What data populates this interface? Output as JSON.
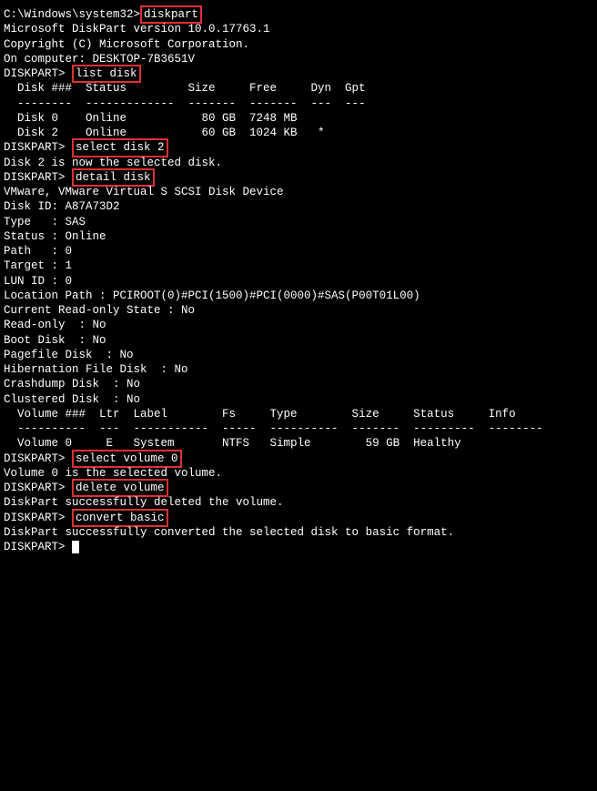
{
  "line1_prefix": "C:\\Windows\\system32>",
  "cmd_diskpart": "diskpart",
  "blank": "",
  "version_line": "Microsoft DiskPart version 10.0.17763.1",
  "copyright_line": "Copyright (C) Microsoft Corporation.",
  "computer_line": "On computer: DESKTOP-7B3651V",
  "prompt": "DISKPART> ",
  "cmd_list_disk": "list disk",
  "disk_header": "  Disk ###  Status         Size     Free     Dyn  Gpt",
  "disk_sep": "  --------  -------------  -------  -------  ---  ---",
  "disk_row0": "  Disk 0    Online           80 GB  7248 MB",
  "disk_row2": "  Disk 2    Online           60 GB  1024 KB   *",
  "cmd_select_disk_2": "select disk 2",
  "msg_disk2_selected": "Disk 2 is now the selected disk.",
  "cmd_detail_disk": "detail disk",
  "detail_device": "VMware, VMware Virtual S SCSI Disk Device",
  "detail_id": "Disk ID: A87A73D2",
  "detail_type": "Type   : SAS",
  "detail_status": "Status : Online",
  "detail_path": "Path   : 0",
  "detail_target": "Target : 1",
  "detail_lun": "LUN ID : 0",
  "detail_location": "Location Path : PCIROOT(0)#PCI(1500)#PCI(0000)#SAS(P00T01L00)",
  "detail_readonly_state": "Current Read-only State : No",
  "detail_readonly": "Read-only  : No",
  "detail_boot": "Boot Disk  : No",
  "detail_pagefile": "Pagefile Disk  : No",
  "detail_hibernation": "Hibernation File Disk  : No",
  "detail_crashdump": "Crashdump Disk  : No",
  "detail_clustered": "Clustered Disk  : No",
  "vol_header": "  Volume ###  Ltr  Label        Fs     Type        Size     Status     Info",
  "vol_sep": "  ----------  ---  -----------  -----  ----------  -------  ---------  --------",
  "vol_row0": "  Volume 0     E   System       NTFS   Simple        59 GB  Healthy",
  "cmd_select_volume_0": "select volume 0",
  "msg_vol0_selected": "Volume 0 is the selected volume.",
  "cmd_delete_volume": "delete volume",
  "msg_deleted": "DiskPart successfully deleted the volume.",
  "cmd_convert_basic": "convert basic",
  "msg_converted": "DiskPart successfully converted the selected disk to basic format."
}
